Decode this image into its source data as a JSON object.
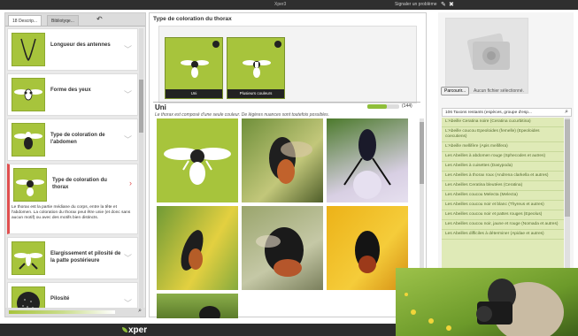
{
  "topbar": {
    "app_title": "Xper3",
    "report_label": "Signaler un problème",
    "edit_icon": "pencil-icon",
    "close_icon": "close-icon"
  },
  "left_panel": {
    "tabs": [
      {
        "label": "18 Descrip..."
      },
      {
        "label": "Bibliotyqe..."
      }
    ],
    "back_icon": "undo-arrow-icon",
    "descriptors": [
      {
        "label": "Longueur des antennes",
        "icon": "antennae-icon"
      },
      {
        "label": "Forme des yeux",
        "icon": "bee-eyes-icon"
      },
      {
        "label": "Type de coloration de l'abdomen",
        "icon": "bee-abdomen-icon"
      },
      {
        "label": "Type de coloration du thorax",
        "icon": "bee-thorax-icon",
        "selected": true,
        "description": "Le thorax est la partie médiane du corps, entre la tête et l'abdomen. La coloration du thorax peut être unie (et donc sans aucun motif) ou avec des motifs bien distincts."
      },
      {
        "label": "Elargissement et pilosité de la patte postérieure",
        "icon": "bee-leg-icon"
      },
      {
        "label": "Pilosité",
        "icon": "hair-texture-icon"
      }
    ],
    "search_icon": "search-icon"
  },
  "center_panel": {
    "title": "Type de coloration du thorax",
    "states": [
      {
        "label": "Uni"
      },
      {
        "label": "Plusieurs couleurs"
      }
    ],
    "current_state": {
      "name": "Uni",
      "description": "Le thorax est composé d'une seule couleur. De légères nuances sont toutefois possibles.",
      "progress": 0.6,
      "count": "(144)"
    },
    "photos": [
      {
        "caption": "",
        "kind": "illustration"
      },
      {
        "caption": "",
        "kind": "photo"
      },
      {
        "caption": "",
        "kind": "photo"
      },
      {
        "caption": "",
        "kind": "photo"
      },
      {
        "caption": "",
        "kind": "photo"
      },
      {
        "caption": "",
        "kind": "photo"
      },
      {
        "caption": "",
        "kind": "photo"
      }
    ]
  },
  "right_panel": {
    "browse_label": "Parcourir...",
    "no_file_label": "Aucun fichier sélectionné.",
    "taxa_header": "106 Taxons restants (espèces, groupe d'esp...",
    "taxa": [
      "L'Abeille Ceratina noire (Ceratina cucurbitina)",
      "L'Abeille coucou Epeoloides (femelle) (Epeoloides coecutiens)",
      "L'Abeille mellifère (Apis mellifera)",
      "Les Abeilles à abdomen rouge (Sphecodes et autres)",
      "Les Abeilles à cuisettes (Dasypoda)",
      "Les Abeilles à thorax roux (Andrena clarkella et autres)",
      "Les Abeilles Ceratina bleutées (Ceratina)",
      "Les Abeilles coucou Melecta (Melecta)",
      "Les Abeilles coucou noir et blanc (Thyreus et autres)",
      "Les Abeilles coucou noir et pattes rouges (Epeolus)",
      "Les Abeilles coucou noir, jaune et rouge (Nomada et autres)",
      "Les Abeilles difficiles à déterminer (Apidae et autres)"
    ]
  },
  "bottombar": {
    "logo_text": "xper"
  },
  "colors": {
    "accent_green": "#a7c43c",
    "selection_red": "#e05050",
    "taxa_bg": "#dfeab7",
    "bar_dark": "#2f2f2f"
  }
}
